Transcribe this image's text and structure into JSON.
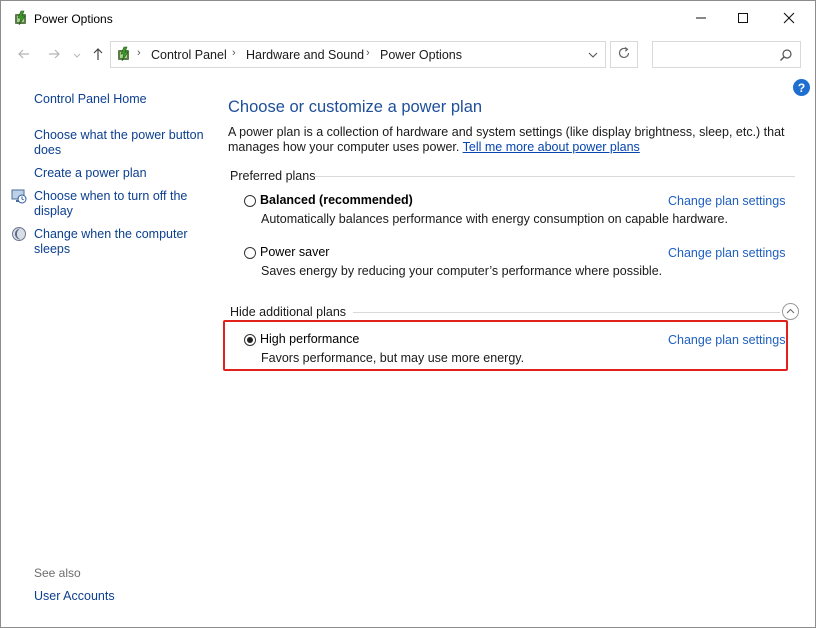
{
  "window": {
    "title": "Power Options",
    "icons": {
      "app": "power-options-icon",
      "minimize": "minimize-icon",
      "maximize": "maximize-icon",
      "close": "close-icon"
    }
  },
  "address_bar": {
    "breadcrumbs": [
      "Control Panel",
      "Hardware and Sound",
      "Power Options"
    ],
    "separator": "›",
    "search_placeholder": "",
    "icons": {
      "back": "back-arrow-icon",
      "forward": "forward-arrow-icon",
      "up": "up-arrow-icon",
      "dropdown": "chevron-down-icon",
      "refresh": "refresh-icon",
      "search": "search-icon",
      "help": "help-icon"
    }
  },
  "help_label": "?",
  "sidebar": {
    "home": "Control Panel Home",
    "links": [
      {
        "label_line1": "Choose what the power button",
        "label_line2": "does",
        "icon": ""
      },
      {
        "label_line1": "Create a power plan",
        "label_line2": "",
        "icon": ""
      },
      {
        "label_line1": "Choose when to turn off the",
        "label_line2": "display",
        "icon": "display-icon"
      },
      {
        "label_line1": "Change when the computer",
        "label_line2": "sleeps",
        "icon": "moon-icon"
      }
    ],
    "see_also_label": "See also",
    "see_also_links": [
      "User Accounts"
    ]
  },
  "main": {
    "title": "Choose or customize a power plan",
    "description": "A power plan is a collection of hardware and system settings (like display brightness, sleep, etc.) that manages how your computer uses power.",
    "description_line1": "A power plan is a collection of hardware and system settings (like display brightness, sleep, etc.) that",
    "description_line2": "manages how your computer uses power.",
    "learn_more_link": "Tell me more about power plans",
    "preferred_label": "Preferred plans",
    "additional_label": "Hide additional plans",
    "plans": [
      {
        "name": "Balanced (recommended)",
        "description": "Automatically balances performance with energy consumption on capable hardware.",
        "selected": false,
        "change_link": "Change plan settings",
        "bold": true
      },
      {
        "name": "Power saver",
        "description": "Saves energy by reducing your computer’s performance where possible.",
        "selected": false,
        "change_link": "Change plan settings",
        "bold": false
      },
      {
        "name": "High performance",
        "description": "Favors performance, but may use more energy.",
        "selected": true,
        "change_link": "Change plan settings",
        "bold": false
      }
    ],
    "highlight_color": "#e3211c"
  },
  "colors": {
    "title_blue": "#1e4f9a",
    "link_blue": "#1f5fbf",
    "help_blue": "#1e6fd0"
  }
}
